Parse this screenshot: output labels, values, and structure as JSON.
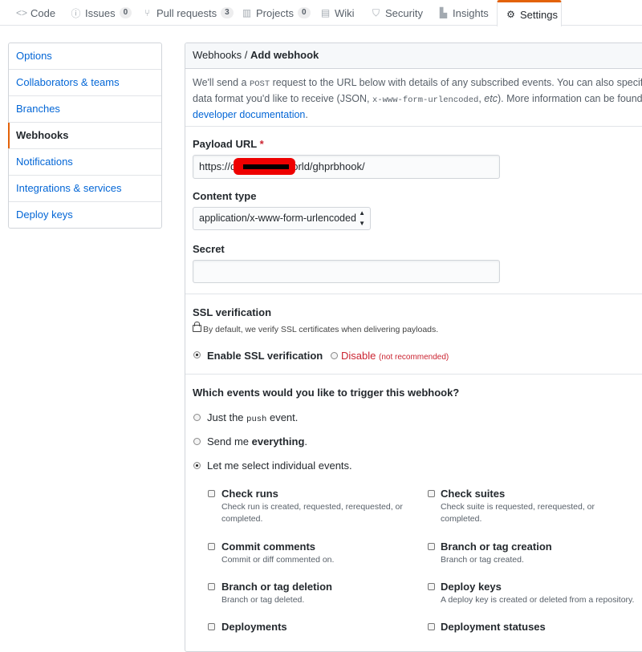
{
  "nav": {
    "tabs": [
      {
        "label": "Code",
        "icon": "code-icon"
      },
      {
        "label": "Issues",
        "count": "0",
        "icon": "issue-icon"
      },
      {
        "label": "Pull requests",
        "count": "3",
        "icon": "pull-request-icon"
      },
      {
        "label": "Projects",
        "count": "0",
        "icon": "project-icon"
      },
      {
        "label": "Wiki",
        "icon": "book-icon"
      },
      {
        "label": "Security",
        "icon": "shield-icon"
      },
      {
        "label": "Insights",
        "icon": "graph-icon"
      },
      {
        "label": "Settings",
        "icon": "gear-icon",
        "selected": true
      }
    ]
  },
  "menu": {
    "items": [
      {
        "label": "Options"
      },
      {
        "label": "Collaborators & teams"
      },
      {
        "label": "Branches"
      },
      {
        "label": "Webhooks",
        "selected": true
      },
      {
        "label": "Notifications"
      },
      {
        "label": "Integrations & services"
      },
      {
        "label": "Deploy keys"
      }
    ]
  },
  "header": {
    "crumb": "Webhooks",
    "sep": " / ",
    "title": "Add webhook"
  },
  "intro": {
    "line1_a": "We'll send a ",
    "line1_code": "POST",
    "line1_b": " request to the URL below with details of any subscribed events. You can also specify w",
    "line2_a": "data format you'd like to receive (JSON, ",
    "line2_code": "x-www-form-urlencoded",
    "line2_b": ", ",
    "line2_etc": "etc",
    "line2_c": "). More information can be found in",
    "link": "developer documentation",
    "link_end": "."
  },
  "payload": {
    "label": "Payload URL",
    "required": "*",
    "value_start": "https://d",
    "value_end": "orld/ghprbhook/"
  },
  "content_type": {
    "label": "Content type",
    "value": "application/x-www-form-urlencoded"
  },
  "secret": {
    "label": "Secret",
    "value": ""
  },
  "ssl": {
    "heading": "SSL verification",
    "note": "By default, we verify SSL certificates when delivering payloads.",
    "enable_label": "Enable SSL verification",
    "disable_label": "Disable",
    "disable_note": "(not recommended)"
  },
  "events": {
    "question": "Which events would you like to trigger this webhook?",
    "opt_push_a": "Just the ",
    "opt_push_code": "push",
    "opt_push_b": " event.",
    "opt_all_a": "Send me ",
    "opt_all_b": "everything",
    "opt_all_c": ".",
    "opt_select": "Let me select individual events.",
    "list": [
      {
        "title": "Check runs",
        "desc": "Check run is created, requested, rerequested, or completed."
      },
      {
        "title": "Check suites",
        "desc": "Check suite is requested, rerequested, or completed."
      },
      {
        "title": "Commit comments",
        "desc": "Commit or diff commented on."
      },
      {
        "title": "Branch or tag creation",
        "desc": "Branch or tag created."
      },
      {
        "title": "Branch or tag deletion",
        "desc": "Branch or tag deleted."
      },
      {
        "title": "Deploy keys",
        "desc": "A deploy key is created or deleted from a repository."
      },
      {
        "title": "Deployments",
        "desc": ""
      },
      {
        "title": "Deployment statuses",
        "desc": ""
      }
    ]
  }
}
